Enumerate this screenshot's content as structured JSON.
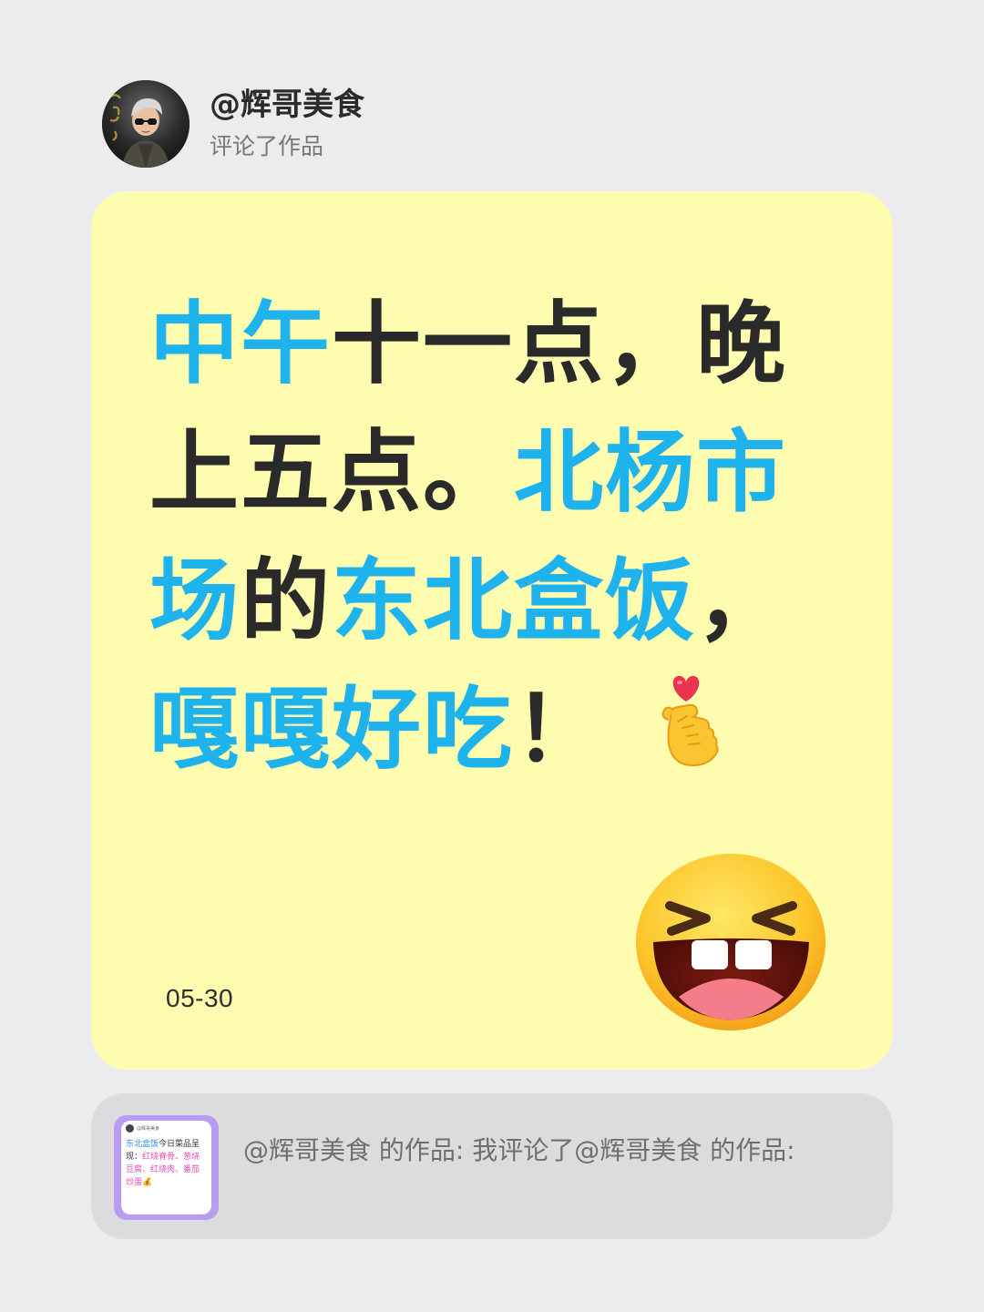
{
  "header": {
    "username": "@辉哥美食",
    "action": "评论了作品"
  },
  "comment": {
    "segments": [
      {
        "text": "中午",
        "style": "highlight"
      },
      {
        "text": "十一点，晚上五点。",
        "style": "dark"
      },
      {
        "text": "北杨市场",
        "style": "highlight"
      },
      {
        "text": "的",
        "style": "dark"
      },
      {
        "text": "东北盒饭",
        "style": "highlight"
      },
      {
        "text": "，",
        "style": "dark"
      },
      {
        "text": "嘎嘎好吃",
        "style": "highlight"
      },
      {
        "text": "！",
        "style": "dark"
      }
    ],
    "emoji_inline": "finger-heart-icon",
    "emoji_sticker": "laughing-face-icon",
    "date": "05-30"
  },
  "reference": {
    "text": "@辉哥美食 的作品: 我评论了@辉哥美食 的作品:",
    "thumbnail": {
      "author": "@辉哥美食",
      "text_line1_blue": "东北盒饭",
      "text_line1_dark": "今日菜品呈现：",
      "text_line2_pink": "红烧脊骨、葱烧豆腐、红烧肉、番茄炒蛋",
      "emoji": "money-bag-icon"
    }
  },
  "colors": {
    "background": "#ececee",
    "card": "#fefcae",
    "highlight": "#1fb3ee",
    "dark_text": "#2a2a2a",
    "reference_box": "#dcdcde",
    "thumbnail_border": "#b79cf2"
  }
}
